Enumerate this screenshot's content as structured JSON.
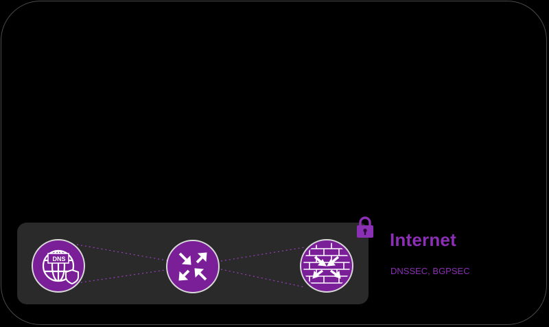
{
  "layer": {
    "title": "Internet",
    "subtitle": "DNSSEC, BGPSEC",
    "dns_badge": "DNS"
  },
  "colors": {
    "accent": "#8b2fb5",
    "node_fill": "#7a1f98",
    "band": "#2a2a2a",
    "background": "#000000"
  },
  "icons": [
    "dns-globe-icon",
    "router-icon",
    "firewall-icon",
    "lock-icon"
  ]
}
